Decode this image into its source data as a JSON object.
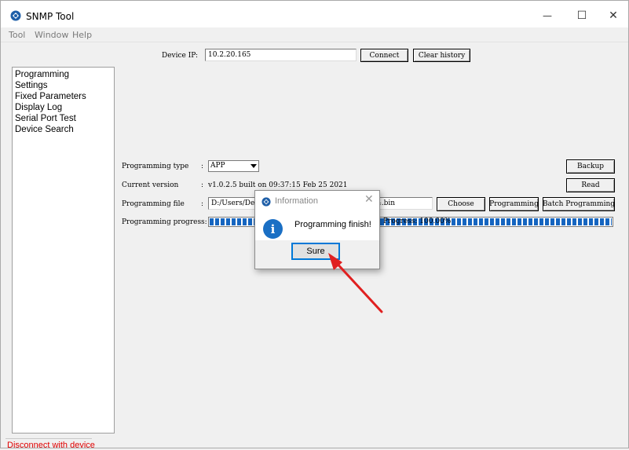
{
  "window": {
    "title": "SNMP Tool",
    "controls": {
      "minimize": "—",
      "maximize": "☐",
      "close": "✕"
    }
  },
  "menu": [
    "Tool",
    "Window",
    "Help"
  ],
  "nav": {
    "items": [
      "Programming",
      "Settings",
      "Fixed Parameters",
      "Display Log",
      "Serial Port Test",
      "Device Search"
    ]
  },
  "device": {
    "label": "Device IP:",
    "value": "10.2.20.165",
    "connect": "Connect",
    "clear_history": "Clear history"
  },
  "programming": {
    "type_label": "Programming type",
    "type_value": "APP",
    "version_label": "Current version",
    "version_value": "v1.0.2.5 built on 09:37:15 Feb 25 2021",
    "file_label": "Programming file",
    "file_value_left": "D:/Users/De",
    "file_value_right": "4.bin",
    "progress_label": "Programming progress:",
    "progress_text": "Progress: 100.00%",
    "progress_fraction": 1.0,
    "colon": ":"
  },
  "buttons": {
    "backup": "Backup",
    "read": "Read",
    "choose": "Choose",
    "programming": "Programming",
    "batch": "Batch Programming"
  },
  "status": {
    "text": "Disconnect with device",
    "color": "#e00000"
  },
  "dialog": {
    "title": "Information",
    "message": "Programming finish!",
    "info_glyph": "i",
    "close_glyph": "✕",
    "ok": "Sure"
  },
  "colors": {
    "accent": "#0078d7",
    "progress": "#1565c0",
    "annotation_arrow": "#e02020"
  },
  "icons": {
    "app": "snmp-app-icon",
    "info": "info-icon",
    "annotation": "red-arrow-annotation"
  }
}
